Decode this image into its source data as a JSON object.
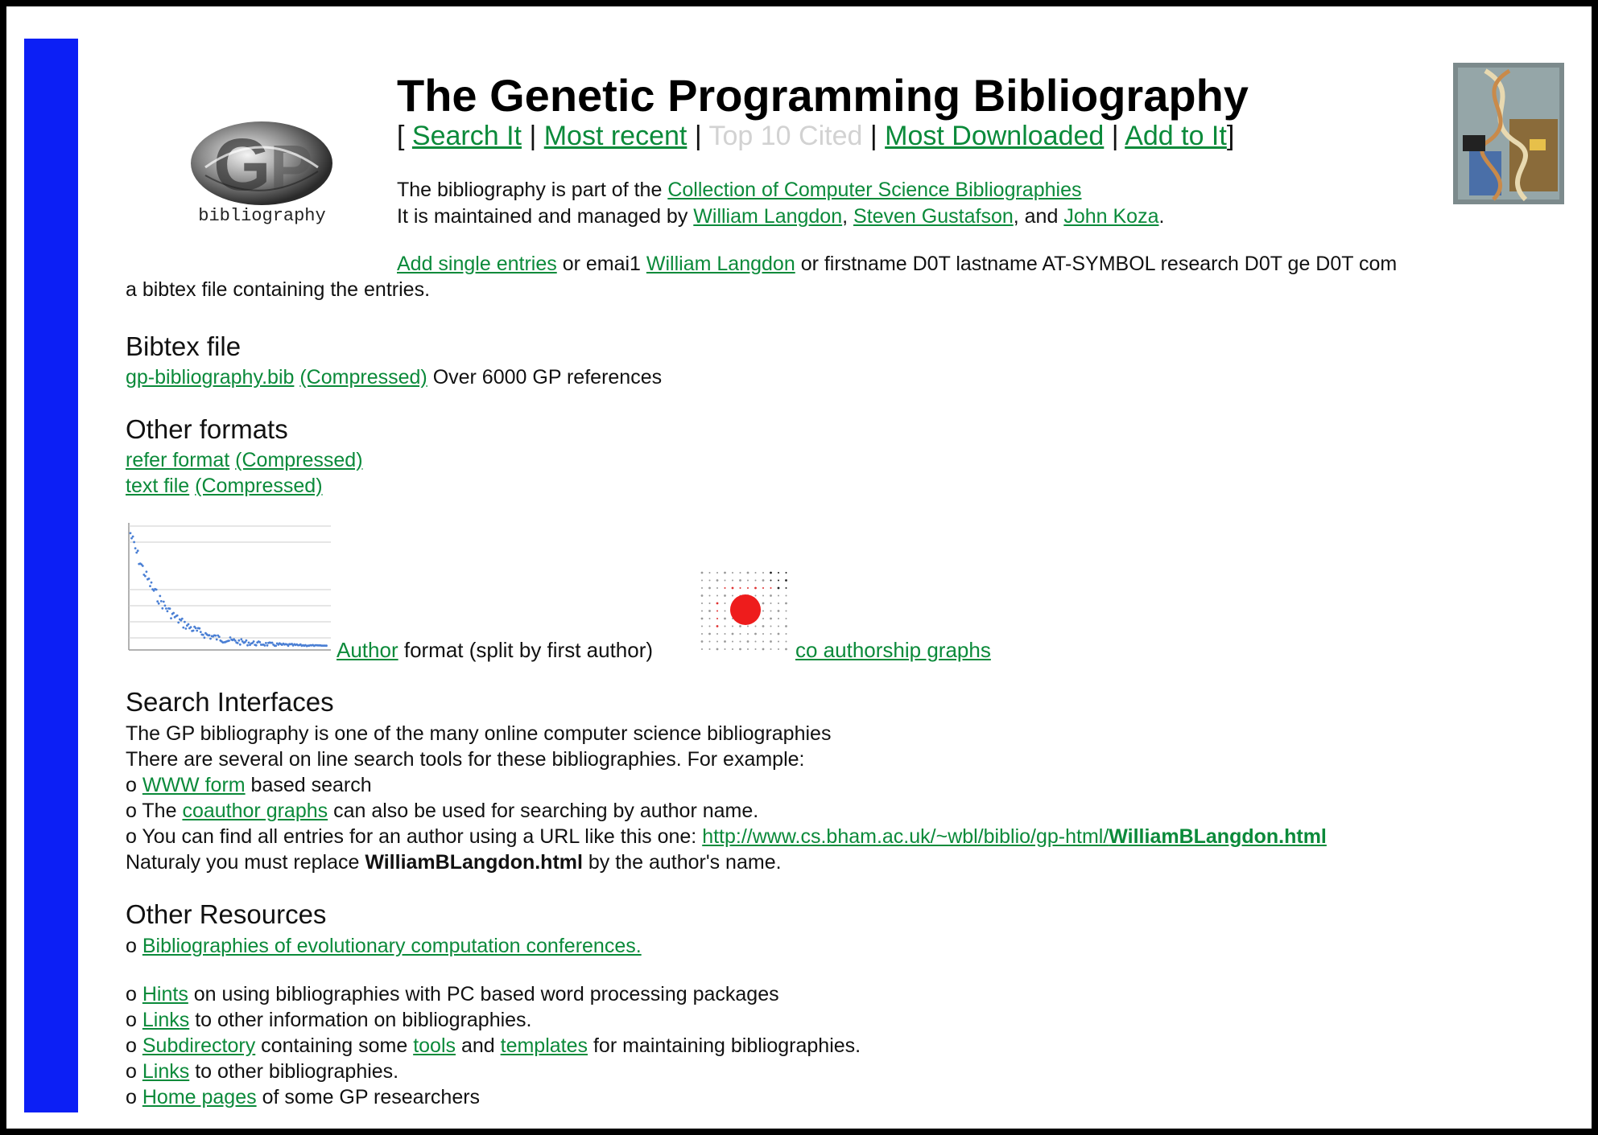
{
  "header": {
    "title": "The Genetic Programming Bibliography",
    "logo_caption": "bibliography",
    "nav": {
      "open": "[",
      "search": "Search It",
      "sep1": "|",
      "recent": "Most recent",
      "sep2": "|",
      "top10": "Top 10 Cited",
      "sep3": "|",
      "downloaded": "Most Downloaded",
      "sep4": "|",
      "add": "Add to It",
      "close": "]"
    }
  },
  "intro": {
    "line1_prefix": "The bibliography is part of the",
    "collection_link": "Collection of Computer Science Bibliographies",
    "line2_prefix": "It is maintained and managed by",
    "maintainer1": "William Langdon",
    "comma": ",",
    "maintainer2": "Steven Gustafson",
    "and": ", and",
    "maintainer3": "John Koza",
    "period": "."
  },
  "add": {
    "link": "Add single entries",
    "mid1": "or emai1",
    "email_link": "William Langdon",
    "mid2": "or firstname D0T lastname AT-SYMBOL research D0T ge D0T com",
    "line2": "a bibtex file containing the entries."
  },
  "bibtex": {
    "title": "Bibtex file",
    "file_link": "gp-bibliography.bib",
    "compressed_link": "(Compressed)",
    "note": "Over 6000 GP references"
  },
  "other_formats": {
    "title": "Other formats",
    "refer_link": "refer format",
    "refer_compressed": "(Compressed)",
    "text_link": "text file",
    "text_compressed": "(Compressed)"
  },
  "author_row": {
    "author_link": "Author",
    "author_text": "format (split by first author)",
    "coauth_link": "co authorship graphs"
  },
  "search": {
    "title": "Search Interfaces",
    "line1": "The GP bibliography is one of the many online computer science bibliographies",
    "line2": "There are several on line search tools for these bibliographies. For example:",
    "bullet": "o",
    "www_link": "WWW form",
    "www_after": "based search",
    "the": "The",
    "coauthor_link": "coauthor graphs",
    "coauthor_after": "can also be used for searching by author name.",
    "url_before": "You can find all entries for an author using a URL like this one:",
    "url_link": "http://www.cs.bham.ac.uk/~wbl/biblio/gp-html/",
    "url_bold": "WilliamBLangdon.html",
    "replace_before": "Naturaly you must replace",
    "replace_bold": "WilliamBLangdon.html",
    "replace_after": "by the author's name."
  },
  "resources": {
    "title": "Other Resources",
    "bullet": "o",
    "conf_link": "Bibliographies of evolutionary computation conferences.",
    "hints_link": "Hints",
    "hints_after": "on using bibliographies with PC based word processing packages",
    "links1_link": "Links",
    "links1_after": "to other information on bibliographies.",
    "subdir_link": "Subdirectory",
    "subdir_mid1": "containing some",
    "tools_link": "tools",
    "subdir_mid2": "and",
    "templates_link": "templates",
    "subdir_after": "for maintaining bibliographies.",
    "links2_link": "Links",
    "links2_after": "to other bibliographies.",
    "home_link": "Home pages",
    "home_after": "of some GP researchers"
  },
  "colors": {
    "sidebar": "#0c1ff5",
    "link": "#0b8a3a",
    "disabled_link": "#d2d2d2"
  }
}
